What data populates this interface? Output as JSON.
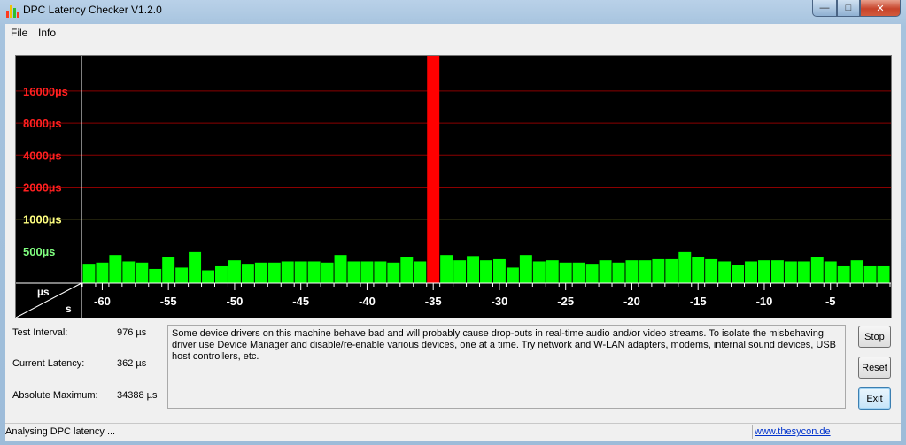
{
  "window": {
    "title": "DPC Latency Checker V1.2.0"
  },
  "menu": {
    "file": "File",
    "info": "Info"
  },
  "graph": {
    "y_tick_labels": [
      "16000µs",
      "8000µs",
      "4000µs",
      "2000µs",
      "1000µs",
      "500µs"
    ],
    "x_tick_labels": [
      "-60",
      "-55",
      "-50",
      "-45",
      "-40",
      "-35",
      "-30",
      "-25",
      "-20",
      "-15",
      "-10",
      "-5"
    ],
    "corner_top": "µs",
    "corner_bottom": "s",
    "colors": {
      "background": "#000000",
      "grid": "#8b0000",
      "threshold_line": "#ffff66",
      "ok_bar": "#00ff00",
      "alert_bar": "#ff0000",
      "red_label": "#ff2020",
      "yellow_label": "#ffff80",
      "green_label": "#80ff80"
    }
  },
  "chart_data": {
    "type": "bar",
    "x": [
      -61,
      -60,
      -59,
      -58,
      -57,
      -56,
      -55,
      -54,
      -53,
      -52,
      -51,
      -50,
      -49,
      -48,
      -47,
      -46,
      -45,
      -44,
      -43,
      -42,
      -41,
      -40,
      -39,
      -38,
      -37,
      -36,
      -35,
      -34,
      -33,
      -32,
      -31,
      -30,
      -29,
      -28,
      -27,
      -26,
      -25,
      -24,
      -23,
      -22,
      -21,
      -20,
      -19,
      -18,
      -17,
      -16,
      -15,
      -14,
      -13,
      -12,
      -11,
      -10,
      -9,
      -8,
      -7,
      -6,
      -5,
      -4,
      -3,
      -2,
      -1
    ],
    "values": [
      380,
      390,
      460,
      400,
      390,
      340,
      440,
      350,
      490,
      330,
      360,
      410,
      380,
      390,
      390,
      400,
      400,
      400,
      390,
      460,
      400,
      400,
      400,
      390,
      440,
      400,
      34388,
      460,
      410,
      450,
      410,
      420,
      350,
      460,
      400,
      410,
      390,
      390,
      380,
      410,
      390,
      410,
      410,
      420,
      420,
      490,
      440,
      420,
      400,
      370,
      400,
      410,
      410,
      400,
      400,
      440,
      400,
      360,
      410,
      360,
      360
    ],
    "xlabel": "s",
    "ylabel": "µs",
    "y_scale": "log",
    "ylim": [
      250,
      34388
    ],
    "grid": true
  },
  "info": {
    "test_interval_label": "Test Interval:",
    "test_interval_value": "976 µs",
    "current_latency_label": "Current Latency:",
    "current_latency_value": "362 µs",
    "absolute_maximum_label": "Absolute Maximum:",
    "absolute_maximum_value": "34388 µs",
    "message": "Some device drivers on this machine behave bad and will probably cause drop-outs in real-time audio and/or video streams. To isolate the misbehaving driver use Device Manager and disable/re-enable various devices, one at a time. Try network and W-LAN adapters, modems, internal sound devices, USB host controllers, etc."
  },
  "buttons": {
    "stop": "Stop",
    "reset": "Reset",
    "exit": "Exit"
  },
  "status": {
    "text": "Analysing DPC latency ...",
    "link": "www.thesycon.de"
  }
}
